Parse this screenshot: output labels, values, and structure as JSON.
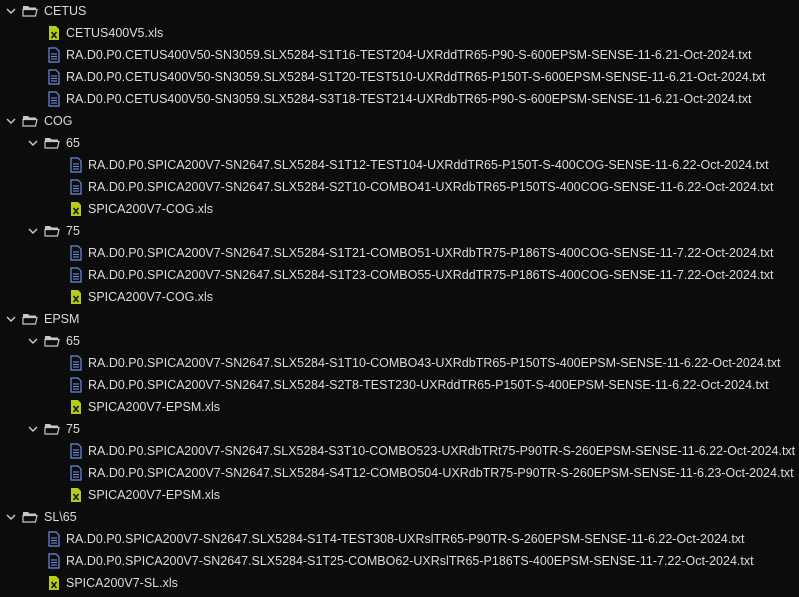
{
  "colors": {
    "background": "#0c0c0c",
    "text": "#dcdcdc",
    "folder_icon": "#c8c8c8",
    "text_file_icon": "#6c8ce0",
    "excel_file_icon": "#b5cc18",
    "chevron": "#cccccc"
  },
  "tree": [
    {
      "type": "folder",
      "name": "CETUS",
      "depth": 0,
      "expanded": true
    },
    {
      "type": "xls",
      "name": "CETUS400V5.xls",
      "depth": 1
    },
    {
      "type": "txt",
      "name": "RA.D0.P0.CETUS400V50-SN3059.SLX5284-S1T16-TEST204-UXRddTR65-P90-S-600EPSM-SENSE-11-6.21-Oct-2024.txt",
      "depth": 1
    },
    {
      "type": "txt",
      "name": "RA.D0.P0.CETUS400V50-SN3059.SLX5284-S1T20-TEST510-UXRddTR65-P150T-S-600EPSM-SENSE-11-6.21-Oct-2024.txt",
      "depth": 1
    },
    {
      "type": "txt",
      "name": "RA.D0.P0.CETUS400V50-SN3059.SLX5284-S3T18-TEST214-UXRdbTR65-P90-S-600EPSM-SENSE-11-6.21-Oct-2024.txt",
      "depth": 1
    },
    {
      "type": "folder",
      "name": "COG",
      "depth": 0,
      "expanded": true
    },
    {
      "type": "folder",
      "name": "65",
      "depth": 1,
      "expanded": true
    },
    {
      "type": "txt",
      "name": "RA.D0.P0.SPICA200V7-SN2647.SLX5284-S1T12-TEST104-UXRddTR65-P150T-S-400COG-SENSE-11-6.22-Oct-2024.txt",
      "depth": 2
    },
    {
      "type": "txt",
      "name": "RA.D0.P0.SPICA200V7-SN2647.SLX5284-S2T10-COMBO41-UXRdbTR65-P150TS-400COG-SENSE-11-6.22-Oct-2024.txt",
      "depth": 2
    },
    {
      "type": "xls",
      "name": "SPICA200V7-COG.xls",
      "depth": 2
    },
    {
      "type": "folder",
      "name": "75",
      "depth": 1,
      "expanded": true
    },
    {
      "type": "txt",
      "name": "RA.D0.P0.SPICA200V7-SN2647.SLX5284-S1T21-COMBO51-UXRdbTR75-P186TS-400COG-SENSE-11-7.22-Oct-2024.txt",
      "depth": 2
    },
    {
      "type": "txt",
      "name": "RA.D0.P0.SPICA200V7-SN2647.SLX5284-S1T23-COMBO55-UXRddTR75-P186TS-400COG-SENSE-11-7.22-Oct-2024.txt",
      "depth": 2
    },
    {
      "type": "xls",
      "name": "SPICA200V7-COG.xls",
      "depth": 2
    },
    {
      "type": "folder",
      "name": "EPSM",
      "depth": 0,
      "expanded": true
    },
    {
      "type": "folder",
      "name": "65",
      "depth": 1,
      "expanded": true
    },
    {
      "type": "txt",
      "name": "RA.D0.P0.SPICA200V7-SN2647.SLX5284-S1T10-COMBO43-UXRdbTR65-P150TS-400EPSM-SENSE-11-6.22-Oct-2024.txt",
      "depth": 2
    },
    {
      "type": "txt",
      "name": "RA.D0.P0.SPICA200V7-SN2647.SLX5284-S2T8-TEST230-UXRddTR65-P150T-S-400EPSM-SENSE-11-6.22-Oct-2024.txt",
      "depth": 2
    },
    {
      "type": "xls",
      "name": "SPICA200V7-EPSM.xls",
      "depth": 2
    },
    {
      "type": "folder",
      "name": "75",
      "depth": 1,
      "expanded": true
    },
    {
      "type": "txt",
      "name": "RA.D0.P0.SPICA200V7-SN2647.SLX5284-S3T10-COMBO523-UXRdbTRt75-P90TR-S-260EPSM-SENSE-11-6.22-Oct-2024.txt",
      "depth": 2
    },
    {
      "type": "txt",
      "name": "RA.D0.P0.SPICA200V7-SN2647.SLX5284-S4T12-COMBO504-UXRdbTR75-P90TR-S-260EPSM-SENSE-11-6.23-Oct-2024.txt",
      "depth": 2
    },
    {
      "type": "xls",
      "name": "SPICA200V7-EPSM.xls",
      "depth": 2
    },
    {
      "type": "folder",
      "name": "SL\\65",
      "depth": 0,
      "expanded": true
    },
    {
      "type": "txt",
      "name": "RA.D0.P0.SPICA200V7-SN2647.SLX5284-S1T4-TEST308-UXRslTR65-P90TR-S-260EPSM-SENSE-11-6.22-Oct-2024.txt",
      "depth": 1
    },
    {
      "type": "txt",
      "name": "RA.D0.P0.SPICA200V7-SN2647.SLX5284-S1T25-COMBO62-UXRslTR65-P186TS-400EPSM-SENSE-11-7.22-Oct-2024.txt",
      "depth": 1
    },
    {
      "type": "xls",
      "name": "SPICA200V7-SL.xls",
      "depth": 1
    }
  ]
}
